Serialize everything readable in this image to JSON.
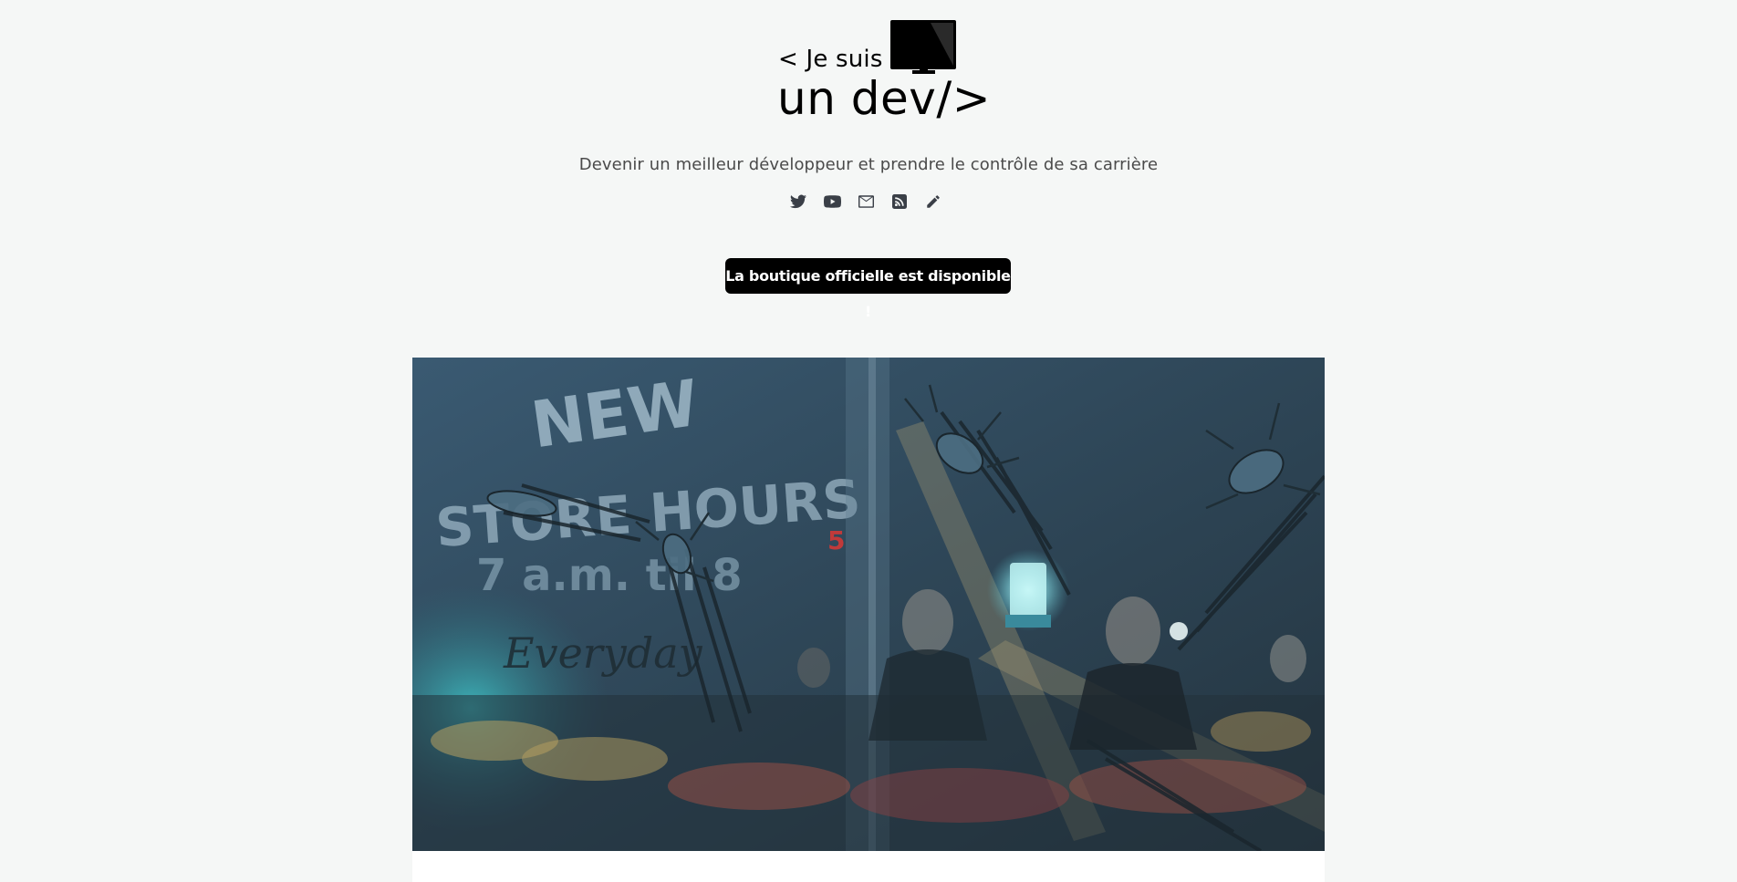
{
  "site": {
    "logo_line1": "< Je suis",
    "logo_line2": "un dev/>",
    "tagline": "Devenir un meilleur développeur et prendre le contrôle de sa carrière"
  },
  "social_links": [
    {
      "icon": "twitter-icon"
    },
    {
      "icon": "youtube-icon"
    },
    {
      "icon": "envelope-icon"
    },
    {
      "icon": "rss-icon"
    },
    {
      "icon": "pencil-icon"
    }
  ],
  "shop_button": {
    "label": "La boutique officielle est disponible !"
  },
  "hero": {
    "sign_text_1": "NEW",
    "sign_text_2": "STORE HOURS",
    "sign_text_3": "7 a.m. til 8",
    "sign_text_4": "Everyday",
    "price_tag": "5"
  },
  "colors": {
    "background": "#f5f7f6",
    "button_bg": "#000000",
    "button_text": "#ffffff",
    "icon": "#3a3f47",
    "tagline": "#4a4a4a"
  }
}
